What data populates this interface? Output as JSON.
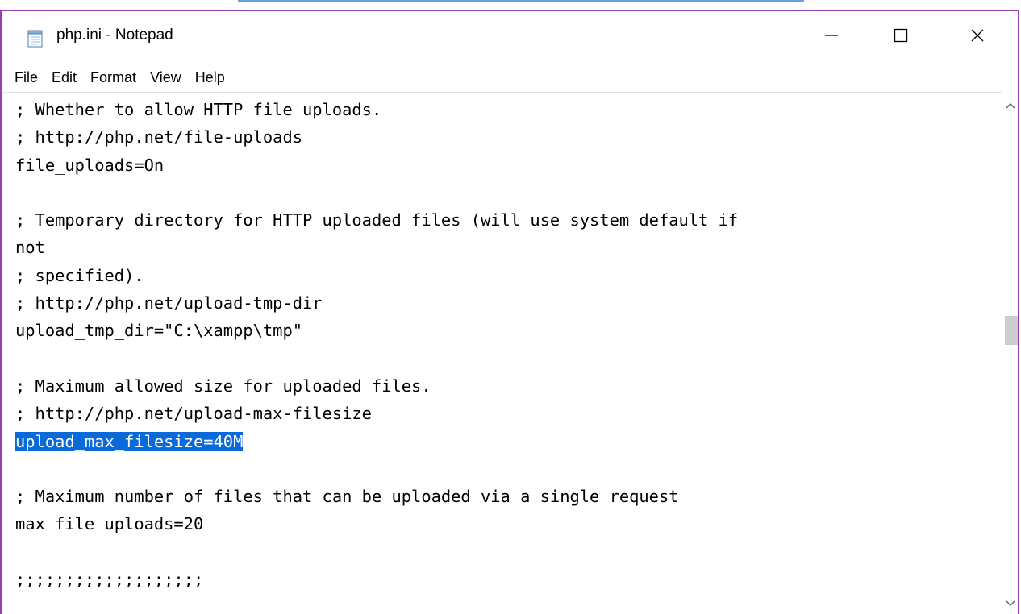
{
  "window": {
    "title": "php.ini - Notepad",
    "app_icon": "notepad-icon",
    "controls": {
      "minimize_icon": "minimize-icon",
      "maximize_icon": "maximize-icon",
      "close_icon": "close-icon"
    },
    "accent_color": "#9b3fb0"
  },
  "menu": {
    "items": [
      {
        "label": "File"
      },
      {
        "label": "Edit"
      },
      {
        "label": "Format"
      },
      {
        "label": "View"
      },
      {
        "label": "Help"
      }
    ]
  },
  "editor": {
    "selection_color": "#0a6ad9",
    "lines": [
      {
        "text": "; Whether to allow HTTP file uploads."
      },
      {
        "text": "; http://php.net/file-uploads"
      },
      {
        "text": "file_uploads=On"
      },
      {
        "text": ""
      },
      {
        "text": "; Temporary directory for HTTP uploaded files (will use system default if"
      },
      {
        "text": "not"
      },
      {
        "text": "; specified)."
      },
      {
        "text": "; http://php.net/upload-tmp-dir"
      },
      {
        "text": "upload_tmp_dir=\"C:\\xampp\\tmp\""
      },
      {
        "text": ""
      },
      {
        "text": "; Maximum allowed size for uploaded files."
      },
      {
        "text": "; http://php.net/upload-max-filesize"
      },
      {
        "text": "upload_max_filesize=40M",
        "selected": true
      },
      {
        "text": ""
      },
      {
        "text": "; Maximum number of files that can be uploaded via a single request"
      },
      {
        "text": "max_file_uploads=20"
      },
      {
        "text": ""
      },
      {
        "text": ";;;;;;;;;;;;;;;;;;;"
      }
    ]
  },
  "scrollbar": {
    "up_icon": "scroll-up-arrow-icon",
    "down_icon": "scroll-down-arrow-icon"
  }
}
